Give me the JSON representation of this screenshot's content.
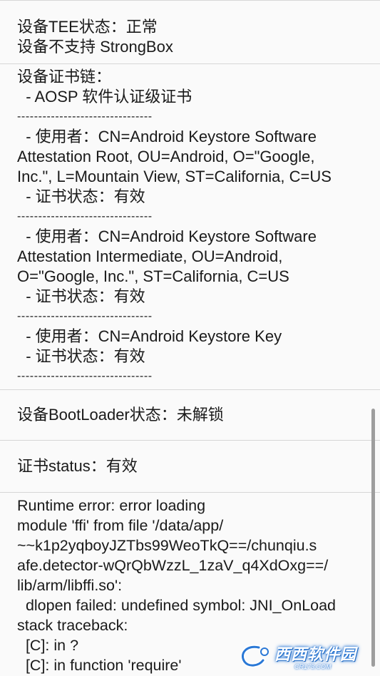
{
  "tee": {
    "status_line": "设备TEE状态：正常",
    "strongbox_line": "设备不支持 StrongBox"
  },
  "cert_chain": {
    "header": "设备证书链：",
    "level": "  - AOSP 软件认证级证书",
    "separator": "--------------------------------",
    "certs": [
      {
        "subject_lines": [
          "  - 使用者：CN=Android Keystore Software",
          "Attestation Root, OU=Android, O=\"Google,",
          "Inc.\", L=Mountain View, ST=California, C=US"
        ],
        "status": "  - 证书状态：有效"
      },
      {
        "subject_lines": [
          "  - 使用者：CN=Android Keystore Software",
          "Attestation Intermediate, OU=Android,",
          "O=\"Google, Inc.\", ST=California, C=US"
        ],
        "status": "  - 证书状态：有效"
      },
      {
        "subject_lines": [
          "  - 使用者：CN=Android Keystore Key"
        ],
        "status": "  - 证书状态：有效"
      }
    ]
  },
  "bootloader": {
    "line": "设备BootLoader状态：未解锁"
  },
  "cert_status": {
    "line": "证书status：有效"
  },
  "error": {
    "lines": [
      "Runtime error: error loading",
      "module 'ffi' from file '/data/app/",
      "~~k1p2yqboyJZTbs99WeoTkQ==/chunqiu.s",
      "afe.detector-wQrQbWzzL_1zaV_q4XdOxg==/",
      "lib/arm/libffi.so':",
      "  dlopen failed: undefined symbol: JNI_OnLoad",
      "stack traceback:",
      "  [C]: in ?",
      "  [C]: in function 'require'"
    ]
  },
  "watermark": {
    "main": "西西软件园",
    "sub": "CR173.COM",
    "accent": "#2a78d6"
  }
}
